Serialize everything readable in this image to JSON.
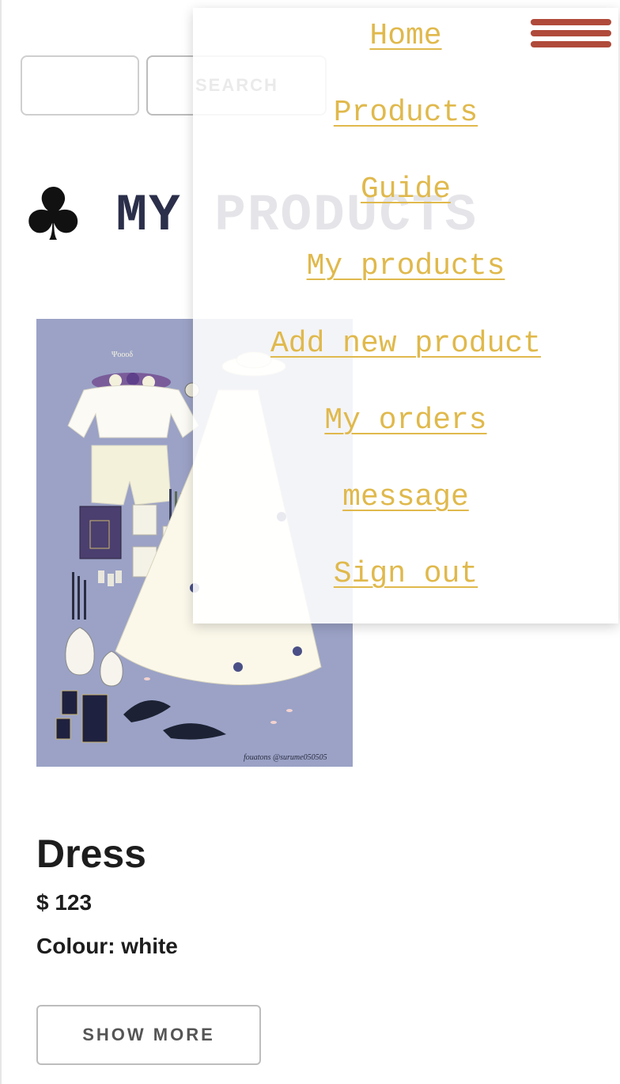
{
  "search": {
    "input_value": "",
    "input_placeholder": "",
    "button_label": "SEARCH"
  },
  "header": {
    "icon": "club-suit-icon",
    "title": "MY PRODUCTS"
  },
  "nav": {
    "items": [
      {
        "label": "Home"
      },
      {
        "label": "Products"
      },
      {
        "label": "Guide"
      },
      {
        "label": "My products"
      },
      {
        "label": "Add new product"
      },
      {
        "label": "My orders"
      },
      {
        "label": "message"
      },
      {
        "label": "Sign out"
      }
    ],
    "link_color": "#e0b94c",
    "hamburger_color": "#b04a3a"
  },
  "product": {
    "image_credit": "fouatons @surume050505",
    "name": "Dress",
    "price": "$ 123",
    "colour": "Colour: white",
    "show_more_label": "SHOW MORE"
  }
}
